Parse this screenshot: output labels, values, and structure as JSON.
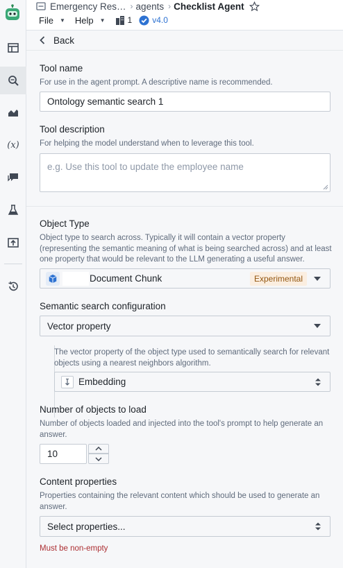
{
  "topbar": {
    "breadcrumbs": [
      "Emergency Res…",
      "agents"
    ],
    "current": "Checklist Agent",
    "menu": {
      "file": "File",
      "help": "Help",
      "count": "1",
      "version": "v4.0"
    }
  },
  "back_label": "Back",
  "tool_name": {
    "label": "Tool name",
    "help": "For use in the agent prompt. A descriptive name is recommended.",
    "value": "Ontology semantic search 1"
  },
  "tool_description": {
    "label": "Tool description",
    "help": "For helping the model understand when to leverage this tool.",
    "placeholder": "e.g. Use this tool to update the employee name"
  },
  "object_type": {
    "label": "Object Type",
    "help": "Object type to search across. Typically it will contain a vector property (representing the semantic meaning of what is being searched across) and at least one property that would be relevant to the LLM generating a useful answer.",
    "value": "Document Chunk",
    "badge": "Experimental"
  },
  "semantic_config": {
    "label": "Semantic search configuration",
    "value": "Vector property",
    "sub_help": "The vector property of the object type used to semantically search for relevant objects using a nearest neighbors algorithm.",
    "sub_value": "Embedding"
  },
  "num_objects": {
    "label": "Number of objects to load",
    "help": "Number of objects loaded and injected into the tool's prompt to help generate an answer.",
    "value": "10"
  },
  "content_properties": {
    "label": "Content properties",
    "help": "Properties containing the relevant content which should be used to generate an answer.",
    "placeholder": "Select properties...",
    "error": "Must be non-empty"
  },
  "colors": {
    "accent": "#2d72d2",
    "error": "#ac2f33",
    "badge_bg": "#fbeee0",
    "badge_fg": "#935610"
  }
}
